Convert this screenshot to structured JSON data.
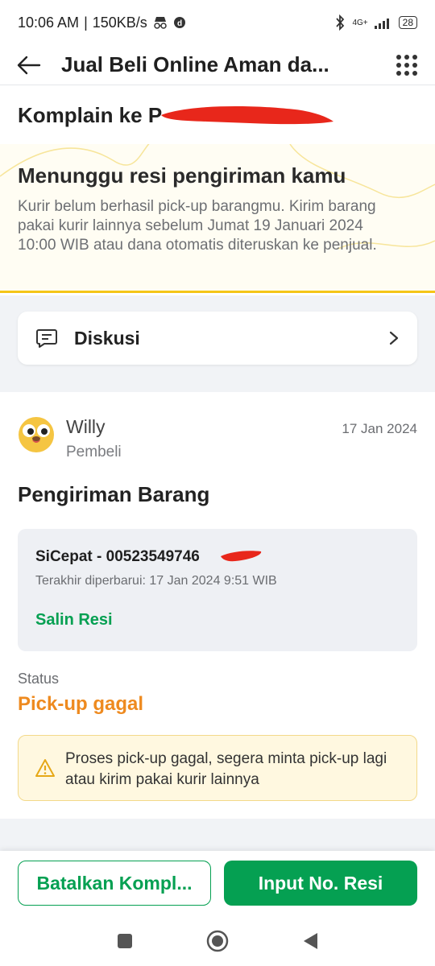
{
  "status_bar": {
    "time": "10:06 AM",
    "network_speed": "150KB/s",
    "battery": "28",
    "signal": "4G+"
  },
  "app_bar": {
    "title": "Jual Beli Online Aman da..."
  },
  "complaint": {
    "title": "Komplain ke P"
  },
  "banner": {
    "title": "Menunggu resi pengiriman kamu",
    "description": "Kurir belum berhasil pick-up barangmu. Kirim barang pakai kurir lainnya sebelum Jumat 19 Januari 2024 10:00 WIB atau dana otomatis diteruskan ke penjual."
  },
  "discussion": {
    "label": "Diskusi"
  },
  "message": {
    "user_name": "Willy",
    "user_role": "Pembeli",
    "date": "17 Jan 2024",
    "section_title": "Pengiriman Barang"
  },
  "shipment": {
    "courier_resi": "SiCepat - 00523549746",
    "last_updated": "Terakhir diperbarui: 17 Jan 2024 9:51 WIB",
    "copy_label": "Salin Resi",
    "status_label": "Status",
    "status_value": "Pick-up gagal"
  },
  "warning": {
    "text": "Proses pick-up gagal, segera minta pick-up lagi atau kirim pakai kurir lainnya"
  },
  "actions": {
    "cancel_label": "Batalkan Kompl...",
    "input_label": "Input No. Resi"
  },
  "colors": {
    "primary_green": "#05a052",
    "status_orange": "#ee8a1f",
    "banner_border": "#f5c518",
    "redaction_red": "#e8271b"
  },
  "icons": {
    "back": "arrow-left-icon",
    "menu": "grid-dots-icon",
    "chat": "chat-bubble-icon",
    "chevron": "chevron-right-icon",
    "warning": "warning-triangle-icon"
  }
}
